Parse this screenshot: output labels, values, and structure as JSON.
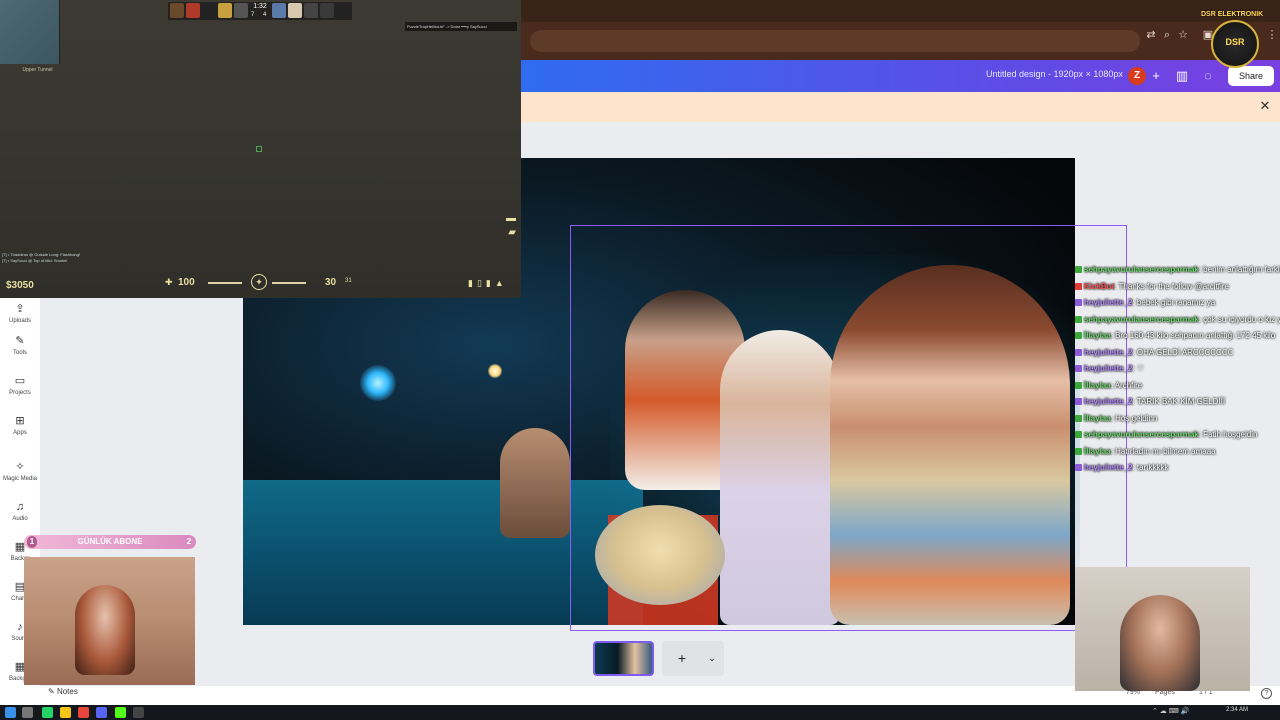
{
  "browser": {
    "icons": [
      "translate-icon",
      "zoom-icon",
      "star-icon",
      "extensions-icon",
      "menu-icon"
    ]
  },
  "canva": {
    "design_title": "Untitled design - 1920px × 1080px",
    "avatar_letter": "Z",
    "share_label": "Share",
    "banner_close": "✕"
  },
  "sidebar": {
    "items": [
      {
        "label": "Uploads",
        "icon": "upload-icon"
      },
      {
        "label": "Tools",
        "icon": "pen-icon"
      },
      {
        "label": "Projects",
        "icon": "folder-icon"
      },
      {
        "label": "Apps",
        "icon": "apps-icon"
      },
      {
        "label": "Magic Media",
        "icon": "magic-icon"
      },
      {
        "label": "Audio",
        "icon": "music-icon"
      },
      {
        "label": "Backgr",
        "icon": "background-icon"
      },
      {
        "label": "Charts",
        "icon": "chart-icon"
      },
      {
        "label": "Sound",
        "icon": "sound-icon"
      },
      {
        "label": "Backgro",
        "icon": "background-icon"
      }
    ]
  },
  "footer": {
    "notes_label": "Notes",
    "zoom": "79%",
    "pages_label": "Pages",
    "page_count": "1 / 1",
    "help": "?"
  },
  "pages": {
    "add_label": "+",
    "dropdown": "⌄"
  },
  "game": {
    "round_timer": "1:32",
    "score_ct": "7",
    "score_t": "4",
    "map_name": "Upper Tunnel",
    "killfeed": "PuzzleTrapHeMoLhF -> Dolar  ━━╤ SaySucci",
    "chat_lines": [
      "[T] • Thaddeus @ Outside Long: Flashbang!",
      "[T] • SaySucci @ Top of Mid: Smoke!"
    ],
    "money": "$3050",
    "health": "100",
    "ammo": "30",
    "ammo_reserve": "31",
    "weapon_primary": "▬",
    "weapon_secondary": "▰",
    "equip": "▮▯▮▲"
  },
  "chat": {
    "messages": [
      {
        "user": "sehpayavurulansercesparmak",
        "color": "green",
        "text": ": benim anlattığım farklı İllayla farklı"
      },
      {
        "user": "KickBot",
        "color": "red",
        "text": ": Thanks for the follow @arcitfire"
      },
      {
        "user": "heyjuliette_2",
        "color": "purple",
        "text": ": bebek gibi ranamız ya"
      },
      {
        "user": "sehpayavurulansercesparmak",
        "color": "green",
        "text": ": çok su içiyordu o kız ya"
      },
      {
        "user": "İllaylaa",
        "color": "green",
        "text": ": Bro 160 43 kilo sehpanın anlattığı 172 45 kilo"
      },
      {
        "user": "heyjuliette_2",
        "color": "purple",
        "text": ": OHA GELDİ ARCCCCCCC"
      },
      {
        "user": "heyjuliette_2",
        "color": "purple",
        "text": ": ♡"
      },
      {
        "user": "İllaylaa",
        "color": "green",
        "text": ": Archfire"
      },
      {
        "user": "heyjuliette_2",
        "color": "purple",
        "text": ": TARIK BAK KİM GELDİİİ"
      },
      {
        "user": "İllaylaa",
        "color": "green",
        "text": ": Hoş geldinn"
      },
      {
        "user": "sehpayavurulansercesparmak",
        "color": "green",
        "text": ": Fatih hoşgeldin"
      },
      {
        "user": "İllaylaa",
        "color": "green",
        "text": ": Hatırladın mı bilmem amaaa"
      },
      {
        "user": "heyjuliette_2",
        "color": "purple",
        "text": ": tarıkkkkk"
      }
    ]
  },
  "subgoal": {
    "left_value": "1",
    "label": "GÜNLÜK ABONE",
    "right_value": "2"
  },
  "branding": {
    "dsr_text": "DSR ELEKTRONIK",
    "dsr_inner": "DSR"
  },
  "taskbar": {
    "clock": "2:34 AM",
    "tray": "⌃ ☁ ⌨ 🔊"
  },
  "colors": {
    "canva_gradient_start": "#2f6cf0",
    "canva_gradient_end": "#7a3fe0",
    "selection": "#8b5cf6",
    "banner": "#fde4cc",
    "sub_goal": "#d98ac0"
  }
}
